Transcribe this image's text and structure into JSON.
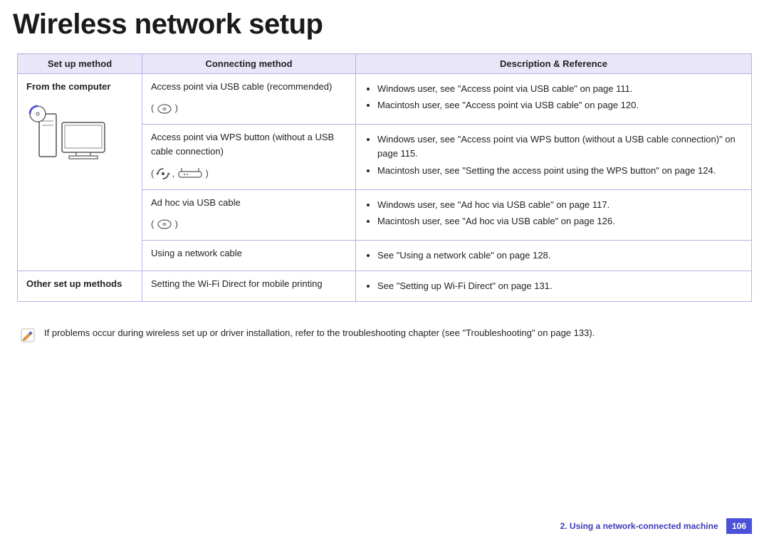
{
  "title": "Wireless network setup",
  "table": {
    "headers": [
      "Set up method",
      "Connecting method",
      "Description & Reference"
    ],
    "rows": [
      {
        "setup": "From the computer",
        "connecting": "Access point via USB cable (recommended)",
        "refs": [
          "Windows user, see \"Access point via USB cable\" on page 111.",
          "Macintosh user, see \"Access point via USB cable\" on page 120."
        ]
      },
      {
        "connecting": "Access point via WPS button (without a USB cable connection)",
        "refs": [
          "Windows user, see \"Access point via WPS button (without a USB cable connection)\" on page 115.",
          "Macintosh user, see \"Setting the access point using the WPS button\" on page 124."
        ]
      },
      {
        "connecting": "Ad hoc via USB cable",
        "refs": [
          "Windows user, see \"Ad hoc via USB cable\" on page 117.",
          "Macintosh user, see \"Ad hoc via USB cable\" on page 126."
        ]
      },
      {
        "connecting": "Using a network cable",
        "refs": [
          "See \"Using a network cable\" on page 128."
        ]
      },
      {
        "setup": "Other set up methods",
        "connecting": "Setting the Wi-Fi Direct for mobile printing",
        "refs": [
          "See \"Setting up Wi-Fi Direct\" on page 131."
        ]
      }
    ]
  },
  "note": "If problems occur during wireless set up or driver installation, refer to the troubleshooting chapter (see \"Troubleshooting\" on page 133).",
  "footer": {
    "chapter": "2.  Using a network-connected machine",
    "page": "106"
  }
}
